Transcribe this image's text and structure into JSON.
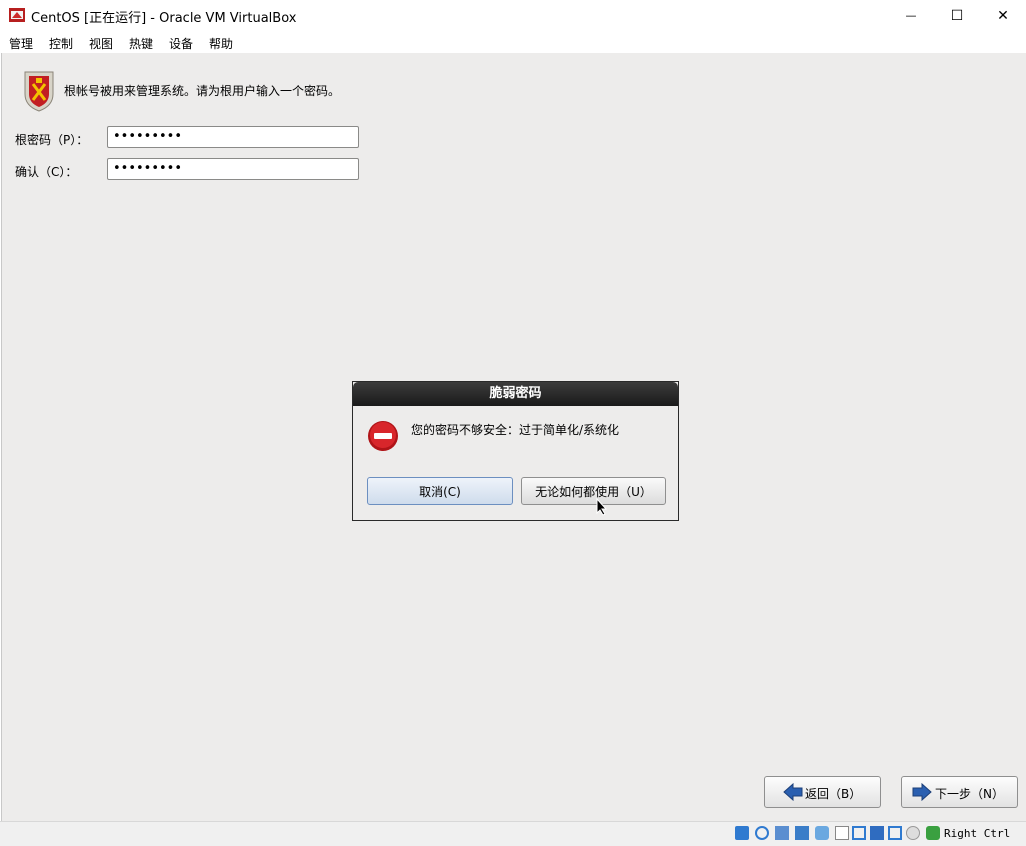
{
  "window": {
    "title": "CentOS [正在运行] - Oracle VM VirtualBox",
    "minimize_glyph": "—",
    "maximize_glyph": "☐",
    "close_glyph": "✕"
  },
  "menu": [
    "管理",
    "控制",
    "视图",
    "热键",
    "设备",
    "帮助"
  ],
  "installer": {
    "header_text": "根帐号被用来管理系统。请为根用户输入一个密码。",
    "root_password_label": "根密码（P）：",
    "root_password_value": "•••••••••",
    "confirm_label": "确认（C）：",
    "confirm_value": "•••••••••",
    "back_label": "返回（B）",
    "next_label": "下一步（N）"
  },
  "dialog": {
    "title": "脆弱密码",
    "message": "您的密码不够安全：过于简单化/系统化",
    "cancel_label": "取消(C)",
    "use_anyway_label": "无论如何都使用（U）"
  },
  "statusbar": {
    "host_key": "Right Ctrl"
  },
  "colors": {
    "accent_blue": "#2a5fb0",
    "stop_red": "#c8171c",
    "guest_bg": "#edeceb"
  }
}
